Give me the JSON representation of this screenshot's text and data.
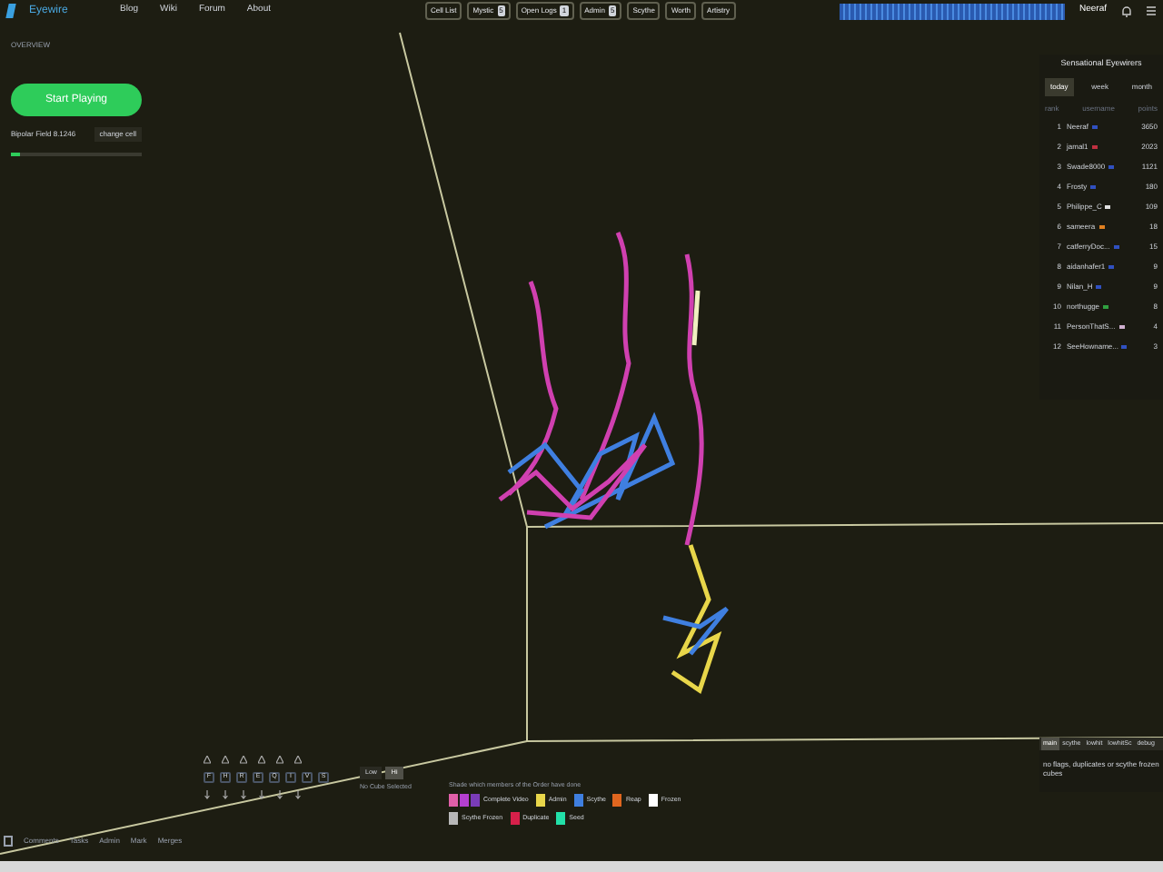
{
  "nav": {
    "logo": "Eyewire",
    "links": [
      "Blog",
      "Wiki",
      "Forum",
      "About"
    ]
  },
  "toolbar": [
    {
      "label": "Cell List"
    },
    {
      "label": "Mystic",
      "badge": "5"
    },
    {
      "label": "Open Logs",
      "badge": "1"
    },
    {
      "label": "Admin",
      "badge": "5"
    },
    {
      "label": "Scythe"
    },
    {
      "label": "Worth"
    },
    {
      "label": "Artistry"
    }
  ],
  "user": {
    "name": "Neeraf"
  },
  "overview": {
    "heading": "OVERVIEW",
    "play_button": "Start Playing",
    "cell": "Bipolar Field 8.1246",
    "change": "change cell",
    "level": 0.07
  },
  "leaderboard": {
    "title": "Sensational Eyewirers",
    "tabs": [
      {
        "label": "today",
        "selected": true
      },
      {
        "label": "week",
        "selected": false
      },
      {
        "label": "month",
        "selected": false
      }
    ],
    "columns": [
      "rank",
      "username",
      "points"
    ],
    "rows": [
      [
        "1",
        "Neeraf",
        "3650"
      ],
      [
        "2",
        "jamal1",
        "2023"
      ],
      [
        "3",
        "Swade8000",
        "1121"
      ],
      [
        "4",
        "Frosty",
        "180"
      ],
      [
        "5",
        "Philippe_C",
        "109"
      ],
      [
        "6",
        "sameera",
        "18"
      ],
      [
        "7",
        "catferryDoc...",
        "15"
      ],
      [
        "8",
        "aidanhafer1",
        "9"
      ],
      [
        "9",
        "Nilan_H",
        "9"
      ],
      [
        "10",
        "northugge",
        "8"
      ],
      [
        "11",
        "PersonThatS...",
        "4"
      ],
      [
        "12",
        "SeeHowname...",
        "3"
      ]
    ]
  },
  "controls": {
    "keys": [
      "F",
      "H",
      "R",
      "E",
      "Q",
      "I",
      "V",
      "S"
    ],
    "quality": [
      {
        "label": "Low",
        "selected": false
      },
      {
        "label": "Hi",
        "selected": true
      }
    ],
    "status": "No Cube Selected"
  },
  "legend": {
    "caption": "Shade which members of the Order have done",
    "items": [
      {
        "label": "Complete Video",
        "swatches": [
          {
            "color": "#e05fa8"
          },
          {
            "color": "#b43fd0"
          },
          {
            "color": "#7a3cb8"
          }
        ]
      },
      {
        "label": "Admin",
        "swatches": [
          {
            "color": "#e8d64a"
          }
        ]
      },
      {
        "label": "Scythe",
        "swatches": [
          {
            "color": "#3f7fe0"
          }
        ]
      },
      {
        "label": "Reap",
        "swatches": [
          {
            "color": "#e0661f"
          }
        ]
      },
      {
        "label": "Frozen",
        "swatches": [
          {
            "color": "#ffffff"
          }
        ]
      },
      {
        "label": "Scythe Frozen",
        "swatches": [
          {
            "color": "#b8b8b8"
          }
        ]
      },
      {
        "label": "Duplicate",
        "swatches": [
          {
            "color": "#d6204a"
          }
        ]
      },
      {
        "label": "Seed",
        "swatches": [
          {
            "color": "#22e0a8"
          }
        ]
      }
    ]
  },
  "flags": {
    "tabs": [
      {
        "label": "main",
        "selected": true
      },
      {
        "label": "scythe",
        "selected": false
      },
      {
        "label": "lowhit",
        "selected": false
      },
      {
        "label": "lowhitSc",
        "selected": false
      },
      {
        "label": "debug",
        "selected": false
      }
    ],
    "message": "no flags, duplicates or scythe frozen cubes"
  },
  "chat": {
    "tabs": [
      "Comments",
      "Tasks",
      "Admin",
      "Mark",
      "Merges"
    ]
  }
}
